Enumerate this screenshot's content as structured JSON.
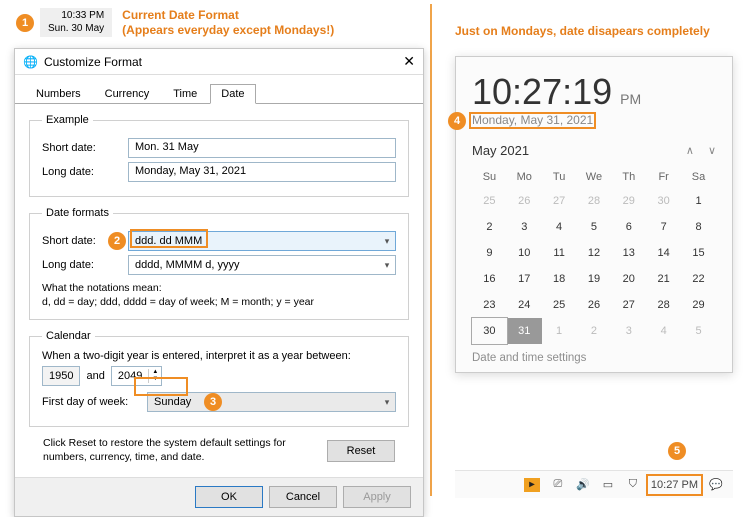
{
  "annotations": {
    "a1": "Current Date  Format",
    "a1b": "(Appears everyday except Mondays!)",
    "a2": "Just on Mondays, date disapears completely"
  },
  "tray_preview": {
    "time": "10:33 PM",
    "date": "Sun. 30 May"
  },
  "dialog": {
    "title": "Customize Format",
    "tabs": [
      "Numbers",
      "Currency",
      "Time",
      "Date"
    ],
    "active_tab": 3,
    "example": {
      "legend": "Example",
      "short_label": "Short date:",
      "long_label": "Long date:",
      "short_value": "Mon. 31 May",
      "long_value": "Monday, May 31, 2021"
    },
    "formats": {
      "legend": "Date formats",
      "short_label": "Short date:",
      "long_label": "Long date:",
      "short_value": "ddd. dd MMM",
      "long_value": "dddd, MMMM d, yyyy",
      "notation_title": "What the notations mean:",
      "notation_text": "d, dd = day;  ddd, dddd = day of week;  M = month;  y = year"
    },
    "calendar": {
      "legend": "Calendar",
      "two_digit_label": "When a two-digit year is entered, interpret it as a year between:",
      "year_from": "1950",
      "and": "and",
      "year_to": "2049",
      "first_day_label": "First day of week:",
      "first_day_value": "Sunday"
    },
    "footer_text": "Click Reset to restore the system default settings for numbers, currency, time, and date.",
    "buttons": {
      "reset": "Reset",
      "ok": "OK",
      "cancel": "Cancel",
      "apply": "Apply"
    }
  },
  "flyout": {
    "time": "10:27:19",
    "ampm": "PM",
    "fulldate": "Monday, May 31, 2021",
    "month_header": "May 2021",
    "dow": [
      "Su",
      "Mo",
      "Tu",
      "We",
      "Th",
      "Fr",
      "Sa"
    ],
    "weeks": [
      [
        {
          "d": 25,
          "out": true
        },
        {
          "d": 26,
          "out": true
        },
        {
          "d": 27,
          "out": true
        },
        {
          "d": 28,
          "out": true
        },
        {
          "d": 29,
          "out": true
        },
        {
          "d": 30,
          "out": true
        },
        {
          "d": 1
        }
      ],
      [
        {
          "d": 2
        },
        {
          "d": 3
        },
        {
          "d": 4
        },
        {
          "d": 5
        },
        {
          "d": 6
        },
        {
          "d": 7
        },
        {
          "d": 8
        }
      ],
      [
        {
          "d": 9
        },
        {
          "d": 10
        },
        {
          "d": 11
        },
        {
          "d": 12
        },
        {
          "d": 13
        },
        {
          "d": 14
        },
        {
          "d": 15
        }
      ],
      [
        {
          "d": 16
        },
        {
          "d": 17
        },
        {
          "d": 18
        },
        {
          "d": 19
        },
        {
          "d": 20
        },
        {
          "d": 21
        },
        {
          "d": 22
        }
      ],
      [
        {
          "d": 23
        },
        {
          "d": 24
        },
        {
          "d": 25
        },
        {
          "d": 26
        },
        {
          "d": 27
        },
        {
          "d": 28
        },
        {
          "d": 29
        }
      ],
      [
        {
          "d": 30,
          "box": true
        },
        {
          "d": 31,
          "today": true
        },
        {
          "d": 1,
          "out": true
        },
        {
          "d": 2,
          "out": true
        },
        {
          "d": 3,
          "out": true
        },
        {
          "d": 4,
          "out": true
        },
        {
          "d": 5,
          "out": true
        }
      ]
    ],
    "settings_link": "Date and time settings"
  },
  "taskbar": {
    "time": "10:27 PM"
  }
}
